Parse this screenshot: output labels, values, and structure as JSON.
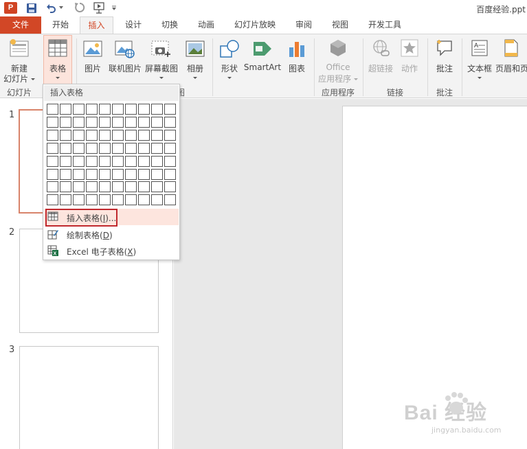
{
  "app": {
    "title": "百度经验.ppt",
    "logo_letter": "P"
  },
  "tabs": [
    {
      "label": "文件",
      "active": false
    },
    {
      "label": "开始",
      "active": false
    },
    {
      "label": "插入",
      "active": true
    },
    {
      "label": "设计",
      "active": false
    },
    {
      "label": "切换",
      "active": false
    },
    {
      "label": "动画",
      "active": false
    },
    {
      "label": "幻灯片放映",
      "active": false
    },
    {
      "label": "审阅",
      "active": false
    },
    {
      "label": "视图",
      "active": false
    },
    {
      "label": "开发工具",
      "active": false
    }
  ],
  "ribbon": {
    "new_slide": {
      "line1": "新建",
      "line2": "幻灯片"
    },
    "table": "表格",
    "picture": "图片",
    "online_picture": "联机图片",
    "screenshot": "屏幕截图",
    "album": "相册",
    "shapes": "形状",
    "smartart": "SmartArt",
    "chart": "图表",
    "office_apps": {
      "line1": "Office",
      "line2": "应用程序"
    },
    "hyperlink": "超链接",
    "action": "动作",
    "comment": "批注",
    "textbox": "文本框",
    "header_footer": "页眉和页",
    "groups": {
      "slides": "幻灯片",
      "illustrations": "插图",
      "apps": "应用程序",
      "links": "链接",
      "comments": "批注"
    }
  },
  "dropdown": {
    "header": "插入表格",
    "grid": {
      "rows": 8,
      "cols": 10
    },
    "items": {
      "insert_table": {
        "label": "插入表格(",
        "key": "I",
        "suffix": ")..."
      },
      "draw_table": {
        "label": "绘制表格(",
        "key": "D",
        "suffix": ")"
      },
      "excel_table": {
        "label": "Excel 电子表格(",
        "key": "X",
        "suffix": ")"
      }
    }
  },
  "slides": [
    {
      "number": "1",
      "selected": true
    },
    {
      "number": "2",
      "selected": false
    },
    {
      "number": "3",
      "selected": false
    }
  ],
  "watermark": {
    "main": "Bai 经验",
    "sub": "jingyan.baidu.com"
  },
  "colors": {
    "accent": "#d24726",
    "highlight_border": "#c0282d"
  }
}
